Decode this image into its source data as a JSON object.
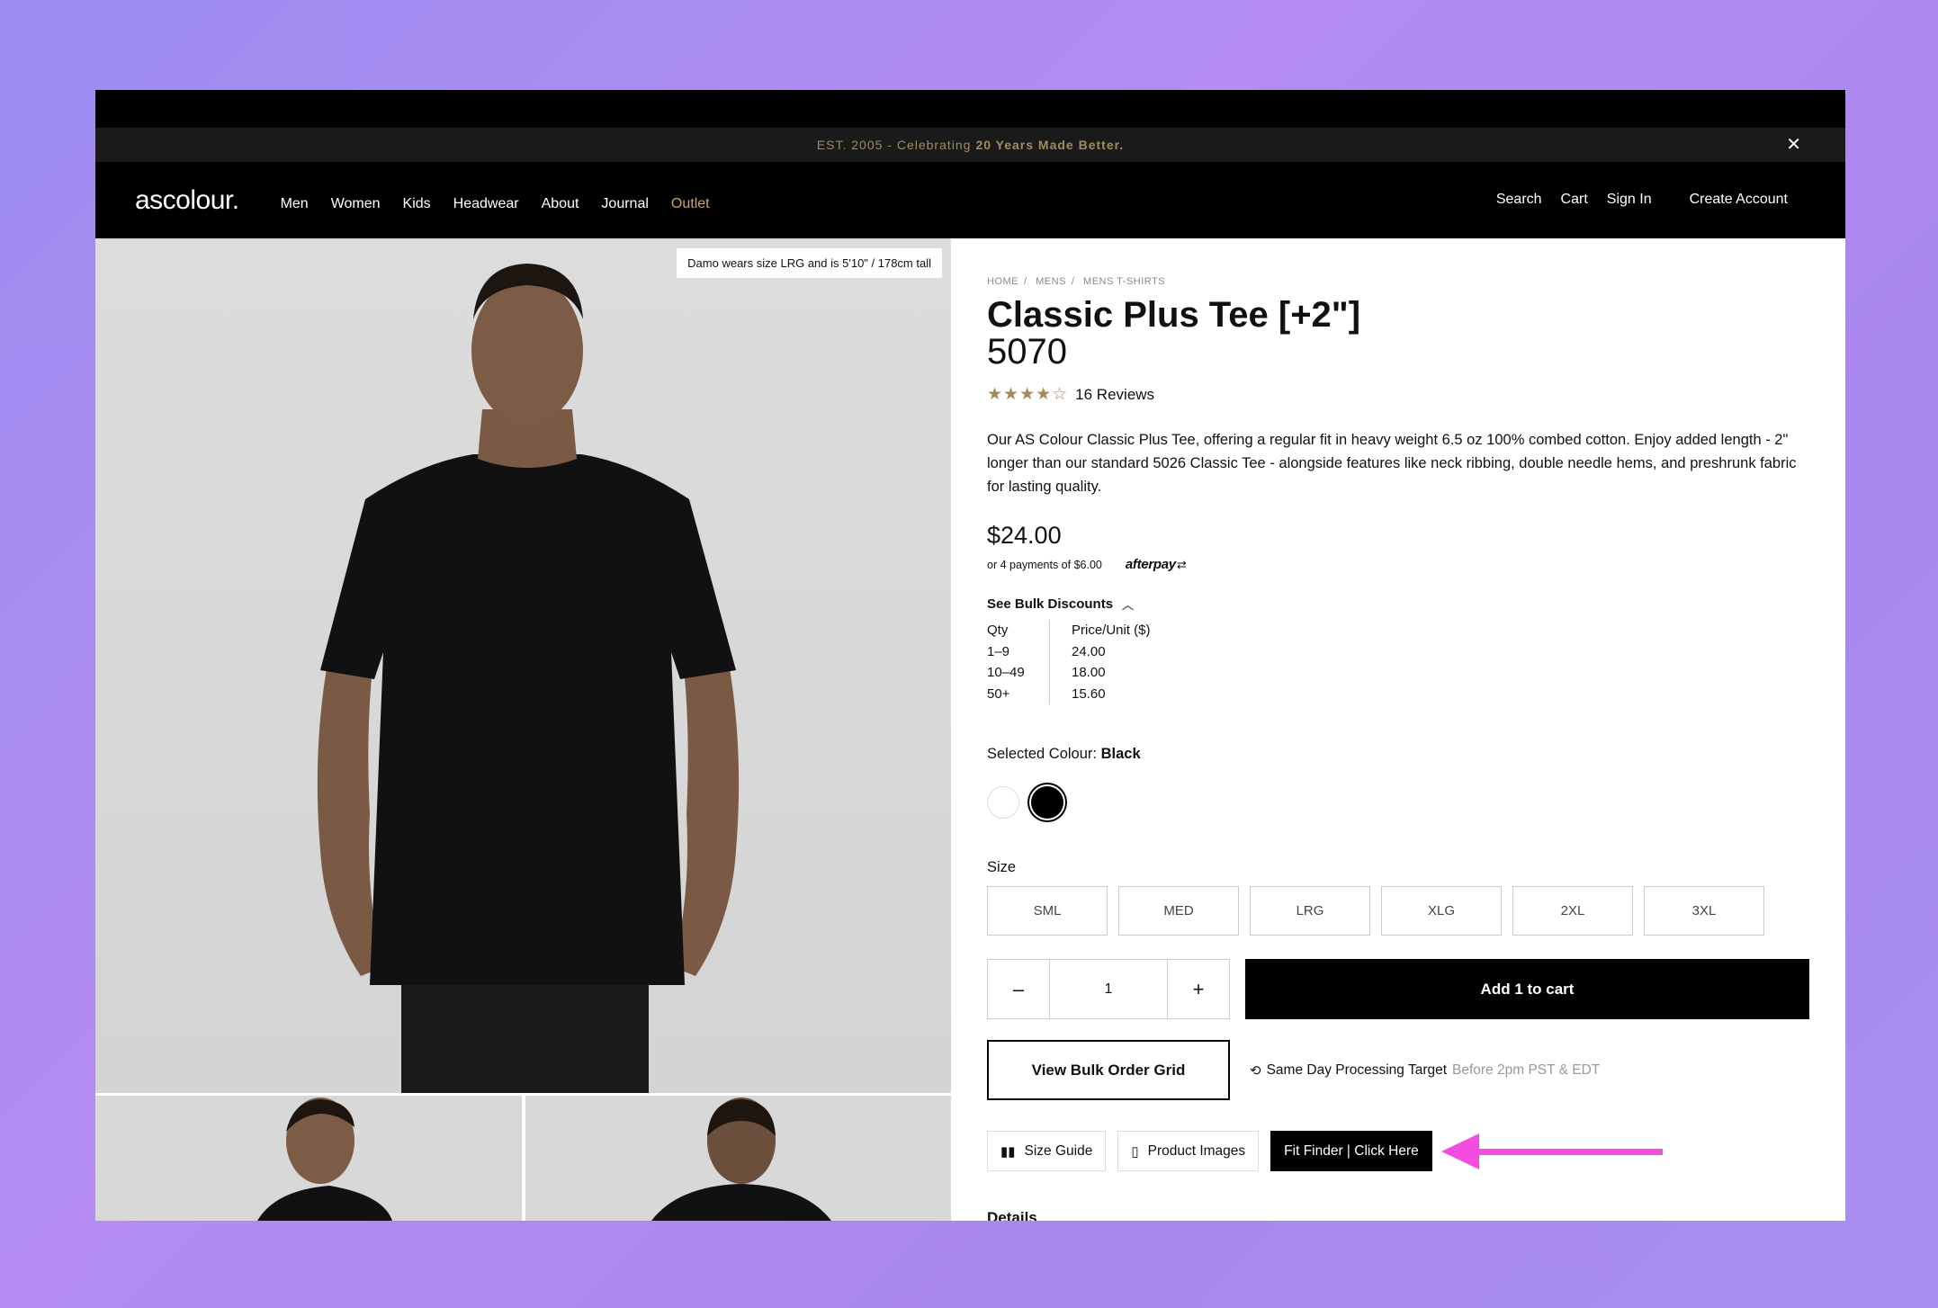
{
  "announcement": {
    "prefix": "EST. 2005 - Celebrating",
    "highlight": "20 Years Made Better.",
    "close_icon": "close-icon"
  },
  "nav": {
    "logo": "ascolour.",
    "left": [
      "Men",
      "Women",
      "Kids",
      "Headwear",
      "About",
      "Journal",
      "Outlet"
    ],
    "right": [
      "Search",
      "Cart",
      "Sign In",
      "Create Account"
    ]
  },
  "gallery": {
    "model_tag": "Damo wears size LRG and is 5'10\" / 178cm tall"
  },
  "product": {
    "breadcrumb": [
      "HOME",
      "MENS",
      "MENS T-SHIRTS"
    ],
    "title": "Classic Plus Tee [+2\"]",
    "code": "5070",
    "rating": 4.5,
    "stars_text": "★★★★☆",
    "reviews": "16 Reviews",
    "description": "Our AS Colour Classic Plus Tee, offering a regular fit in heavy weight 6.5 oz 100% combed cotton. Enjoy added length - 2\" longer than our standard 5026 Classic Tee - alongside features like neck ribbing, double needle hems, and preshrunk fabric for lasting quality.",
    "price": "$24.00",
    "payments": "or 4 payments of  $6.00",
    "afterpay": "afterpay",
    "bulk_toggle": "See Bulk Discounts",
    "bulk_headers": [
      "Qty",
      "Price/Unit ($)"
    ],
    "bulk_rows": [
      {
        "qty": "1–9",
        "price": "24.00"
      },
      {
        "qty": "10–49",
        "price": "18.00"
      },
      {
        "qty": "50+",
        "price": "15.60"
      }
    ],
    "colour_label": "Selected Colour:",
    "colour_value": "Black",
    "size_label": "Size",
    "sizes": [
      "SML",
      "MED",
      "LRG",
      "XLG",
      "2XL",
      "3XL"
    ],
    "quantity": "1",
    "minus": "–",
    "plus": "+",
    "add_to_cart": "Add 1 to cart",
    "bulk_grid": "View Bulk Order Grid",
    "processing": "Same Day Processing Target",
    "processing_note": "Before 2pm PST & EDT",
    "size_guide": "Size Guide",
    "product_images": "Product Images",
    "fit_finder": "Fit Finder | Click Here",
    "details": "Details"
  },
  "colors": {
    "accent_gold": "#a38a5e",
    "outlet": "#c9a56b",
    "arrow": "#f24ddf"
  }
}
